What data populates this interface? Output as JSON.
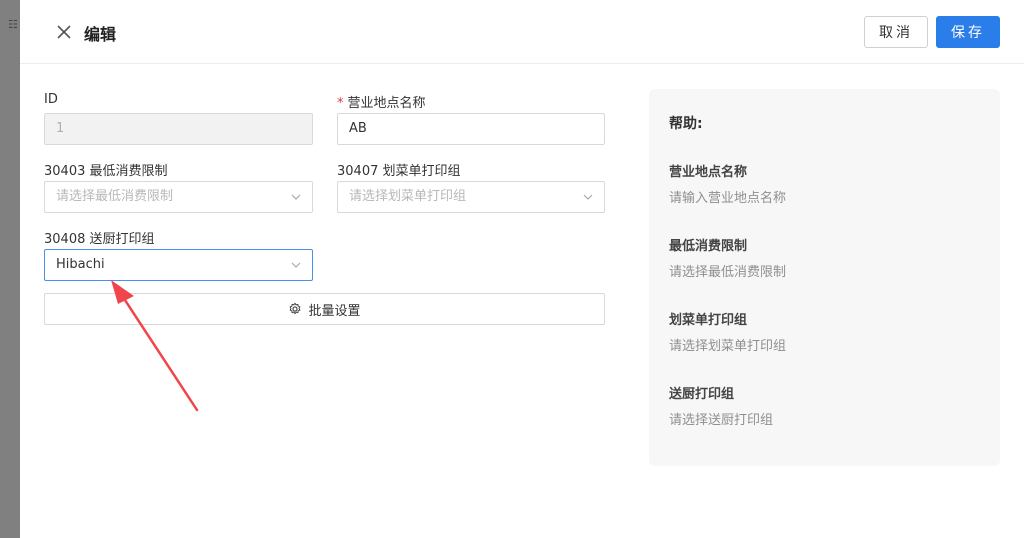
{
  "drawer": {
    "title": "编辑",
    "cancel_label": "取消",
    "save_label": "保存"
  },
  "form": {
    "id_label": "ID",
    "id_value": "1",
    "name_label": "营业地点名称",
    "name_value": "AB",
    "min_spend_label": "30403 最低消费限制",
    "min_spend_placeholder": "请选择最低消费限制",
    "checkoff_label": "30407 划菜单打印组",
    "checkoff_placeholder": "请选择划菜单打印组",
    "kitchen_label": "30408 送厨打印组",
    "kitchen_value": "Hibachi",
    "batch_label": "批量设置"
  },
  "help": {
    "title": "帮助:",
    "items": [
      {
        "title": "营业地点名称",
        "desc": "请输入营业地点名称"
      },
      {
        "title": "最低消费限制",
        "desc": "请选择最低消费限制"
      },
      {
        "title": "划菜单打印组",
        "desc": "请选择划菜单打印组"
      },
      {
        "title": "送厨打印组",
        "desc": "请选择送厨打印组"
      }
    ]
  },
  "colors": {
    "primary": "#2b7de9",
    "required": "#e0383e",
    "annotation_arrow": "#f0464b"
  }
}
